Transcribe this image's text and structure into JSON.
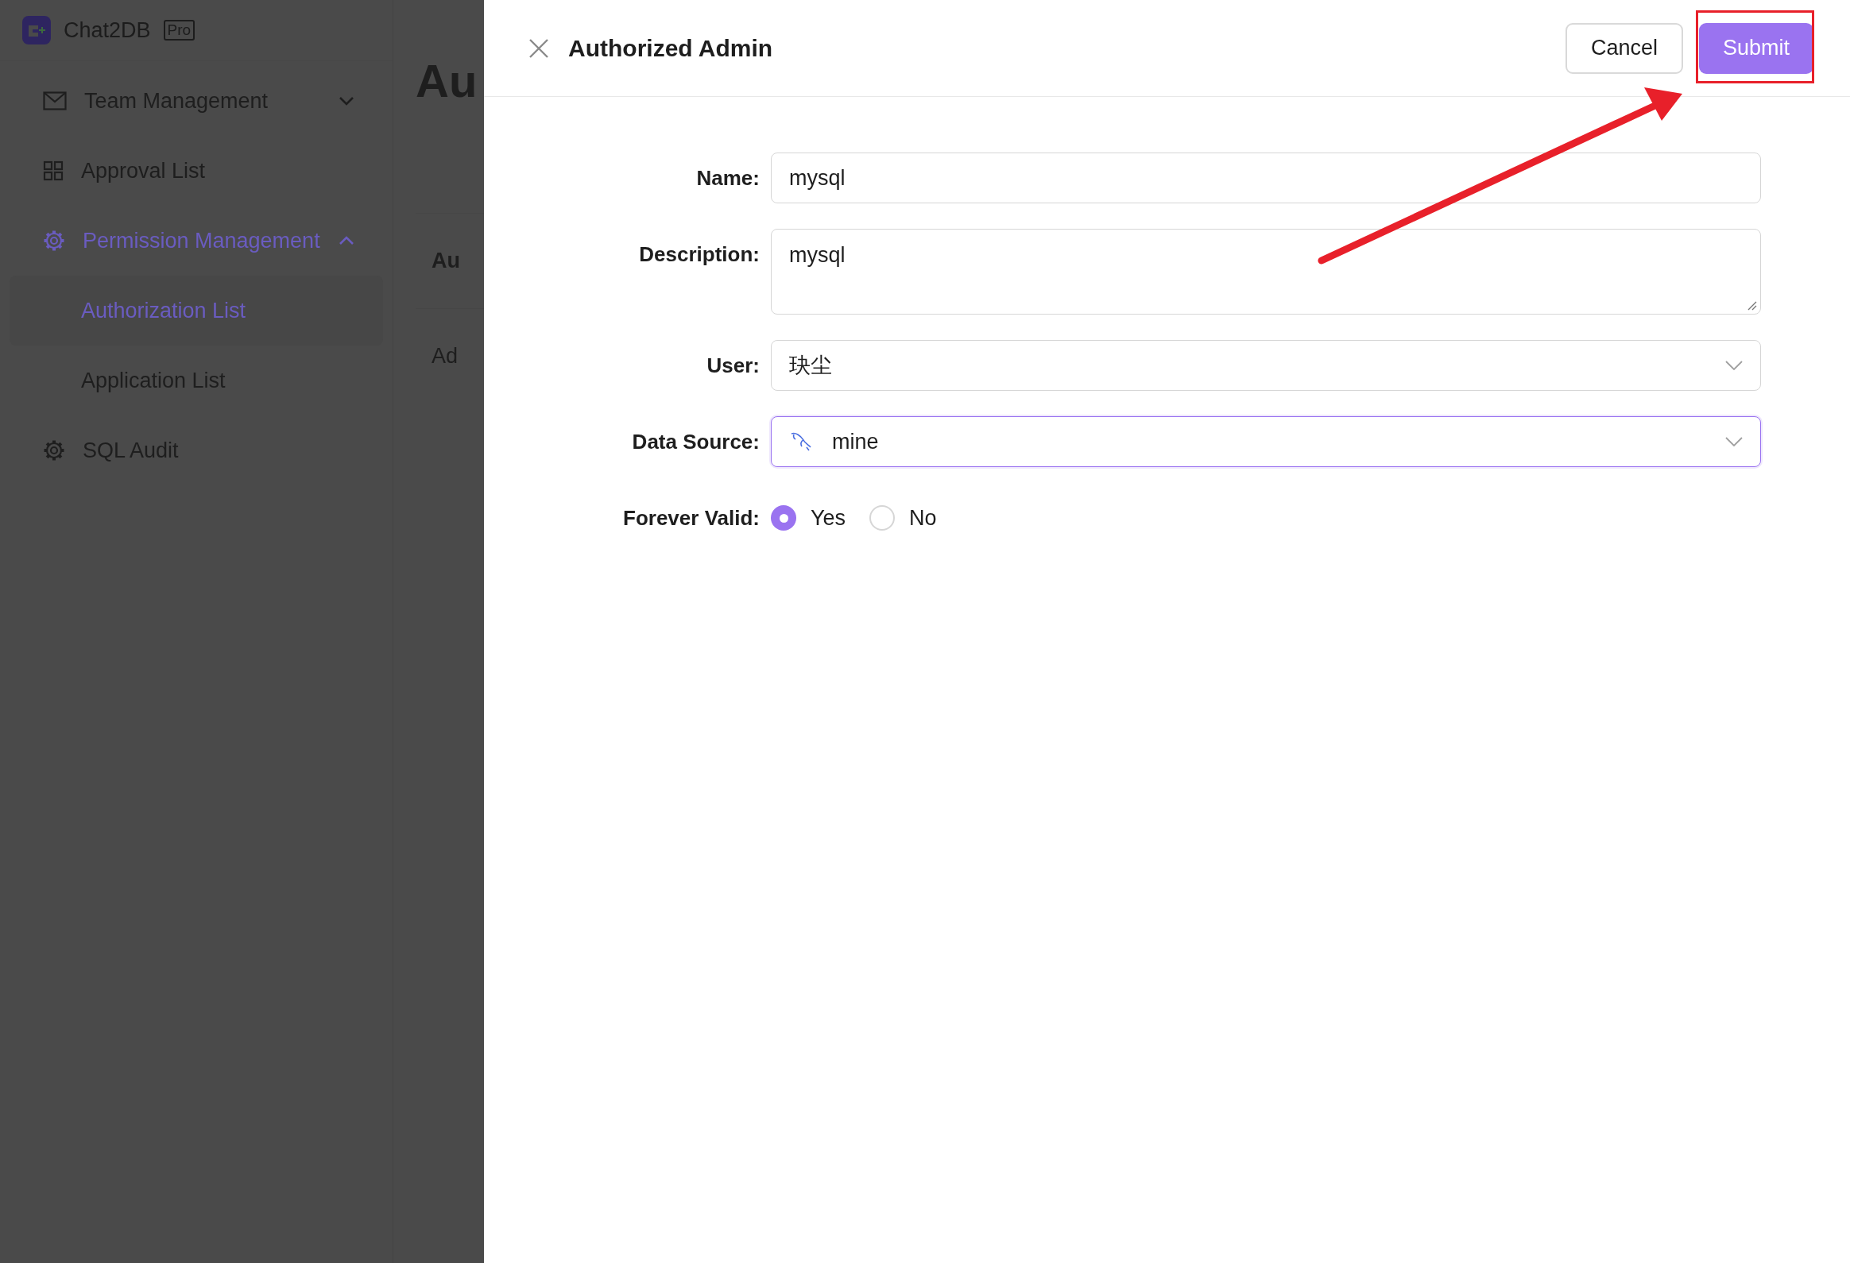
{
  "sidebar": {
    "brand": "Chat2DB",
    "badge": "Pro",
    "items": [
      {
        "label": "Team Management",
        "kind": "group",
        "expanded": false,
        "selected": false
      },
      {
        "label": "Approval List",
        "kind": "link",
        "selected": false
      },
      {
        "label": "Permission Management",
        "kind": "group",
        "expanded": true,
        "selected": true,
        "children": [
          {
            "label": "Authorization List",
            "selected": true
          },
          {
            "label": "Application List",
            "selected": false
          }
        ]
      },
      {
        "label": "SQL Audit",
        "kind": "link",
        "selected": false
      }
    ]
  },
  "page": {
    "title": "Au",
    "rows": [
      "Au",
      "Ad"
    ]
  },
  "drawer": {
    "title": "Authorized Admin",
    "buttons": [
      {
        "label": "Cancel",
        "kind": "default"
      },
      {
        "label": "Submit",
        "kind": "primary"
      }
    ],
    "fields": [
      {
        "label": "Name:",
        "kind": "input",
        "value": "mysql",
        "focused": false
      },
      {
        "label": "Description:",
        "kind": "textarea",
        "value": "mysql",
        "focused": false
      },
      {
        "label": "User:",
        "kind": "select",
        "value": "玦尘",
        "focused": false
      },
      {
        "label": "Data Source:",
        "kind": "select",
        "value": "mine",
        "focused": true,
        "source_icon": true
      },
      {
        "label": "Forever Valid:",
        "kind": "radio",
        "options": [
          {
            "label": "Yes",
            "selected": true
          },
          {
            "label": "No",
            "selected": false
          }
        ]
      }
    ]
  }
}
